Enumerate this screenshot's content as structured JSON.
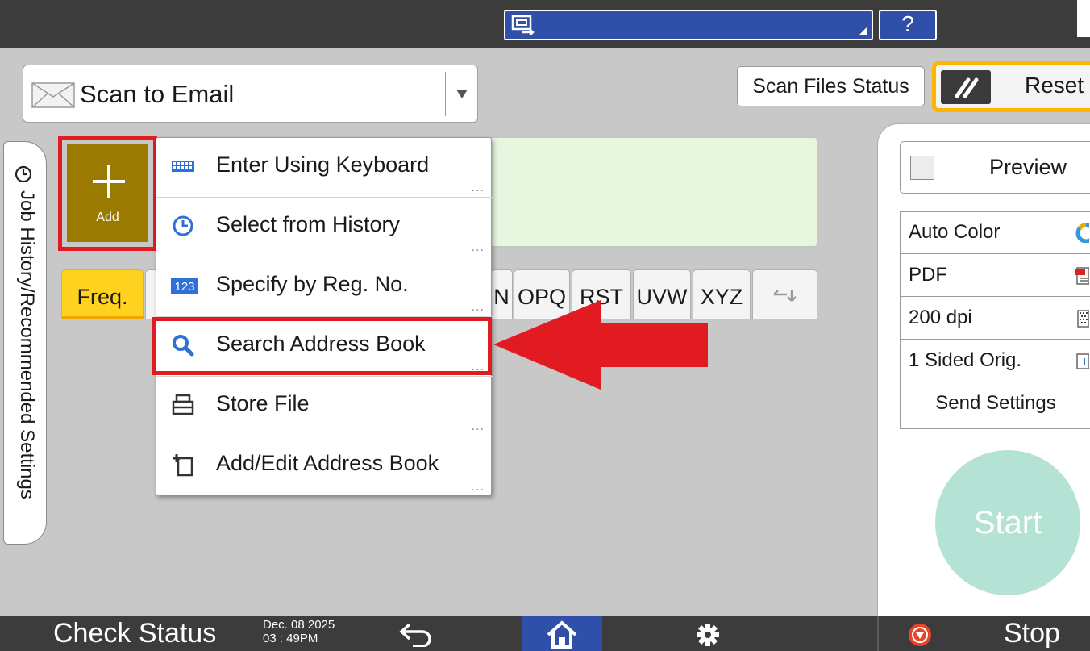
{
  "header": {
    "help_label": "?"
  },
  "app_selector": {
    "label": "Scan to Email"
  },
  "toolbar": {
    "scan_files_status_label": "Scan Files Status",
    "reset_label": "Reset"
  },
  "side_tab": {
    "label": "Job History/Recommended Settings"
  },
  "add_button": {
    "label": "Add"
  },
  "add_menu": {
    "items": [
      {
        "label": "Enter Using Keyboard",
        "icon": "keyboard-icon"
      },
      {
        "label": "Select from History",
        "icon": "history-clock-icon"
      },
      {
        "label": "Specify by Reg. No.",
        "icon": "number-123-icon"
      },
      {
        "label": "Search Address Book",
        "icon": "search-icon"
      },
      {
        "label": "Store File",
        "icon": "store-file-icon"
      },
      {
        "label": "Add/Edit Address Book",
        "icon": "add-edit-address-icon"
      }
    ],
    "more_indicator": "..."
  },
  "index_tabs": {
    "freq": "Freq.",
    "partial": "N",
    "tabs": [
      "OPQ",
      "RST",
      "UVW",
      "XYZ"
    ]
  },
  "right_panel": {
    "preview_label": "Preview",
    "settings": [
      {
        "label": "Auto Color",
        "icon": "auto-color-icon"
      },
      {
        "label": "PDF",
        "icon": "pdf-icon"
      },
      {
        "label": "200 dpi",
        "icon": "resolution-icon"
      },
      {
        "label": "1 Sided Orig.",
        "icon": "one-sided-icon"
      }
    ],
    "send_settings_label": "Send Settings",
    "start_label": "Start"
  },
  "bottom_bar": {
    "check_status_label": "Check Status",
    "date": "Dec. 08 2025",
    "time": "03 : 49PM",
    "stop_label": "Stop"
  },
  "colors": {
    "accent_blue": "#2f4fa8",
    "add_button_bg": "#9b7a02",
    "freq_tab": "#ffd21f",
    "reset_border": "#ffb400",
    "highlight_red": "#e21b22",
    "start_button": "#b4e2d5",
    "dest_area": "#e6f6df"
  }
}
